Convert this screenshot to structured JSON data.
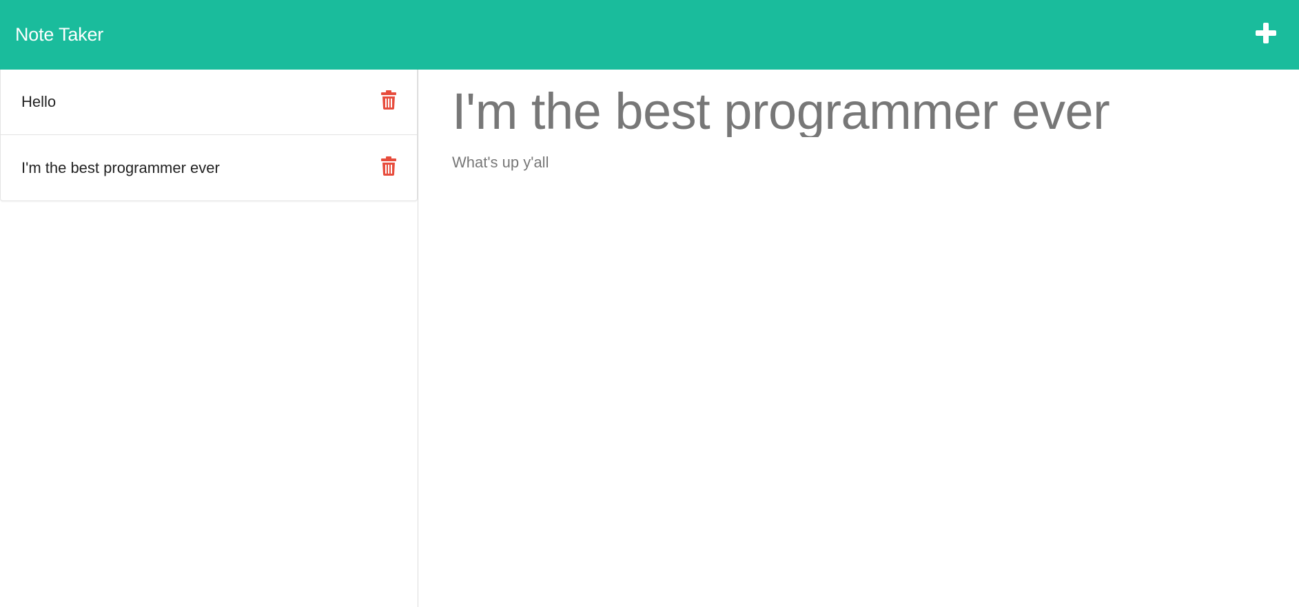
{
  "app": {
    "title": "Note Taker"
  },
  "navbar": {
    "add_icon": "plus-icon",
    "accent_color": "#1abc9c"
  },
  "sidebar": {
    "notes": [
      {
        "title": "Hello",
        "delete_icon": "trash-icon"
      },
      {
        "title": "I'm the best programmer ever",
        "delete_icon": "trash-icon"
      }
    ],
    "delete_color": "#e74c3c"
  },
  "editor": {
    "title": "I'm the best programmer ever",
    "body": "What's up y'all"
  }
}
